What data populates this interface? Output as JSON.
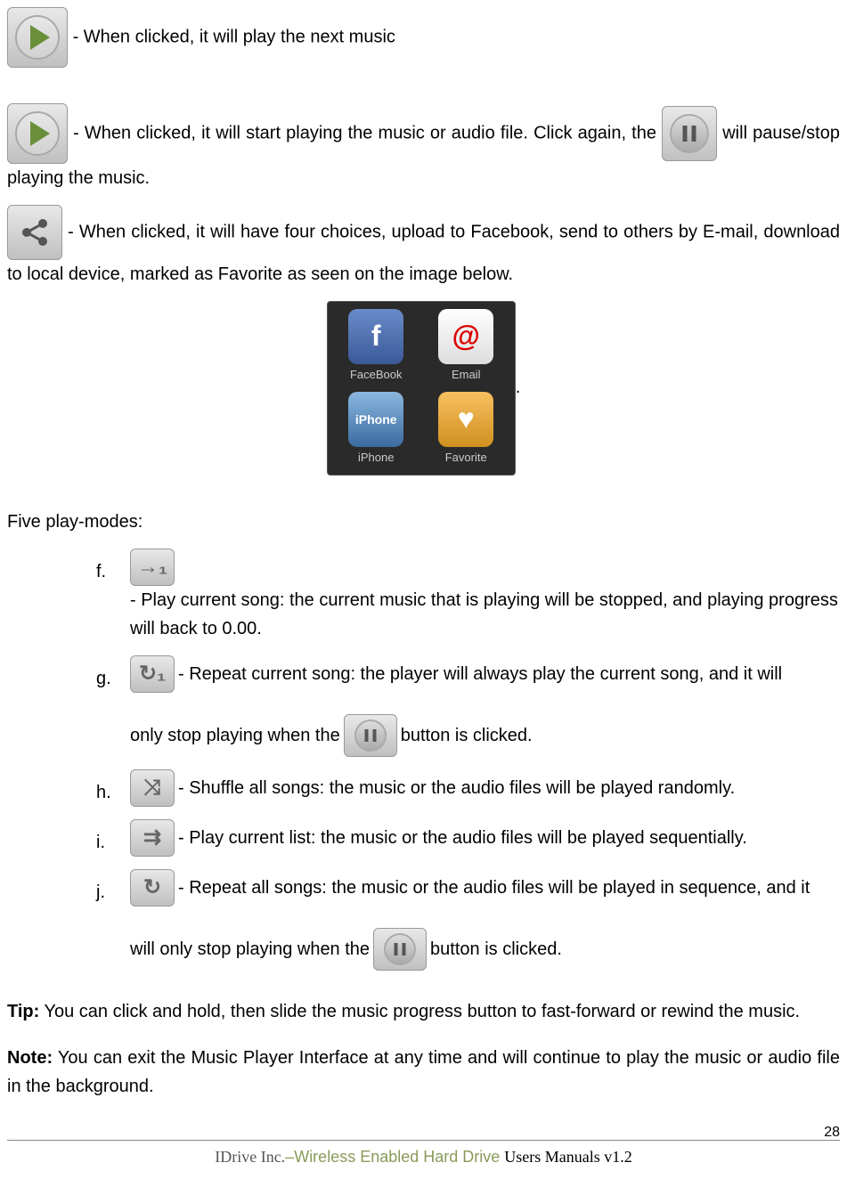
{
  "line_next_music": "- When clicked, it will play the next music",
  "line_play_a": "- When clicked, it will start playing the music or audio file.  Click again, the",
  "line_play_b": "will pause/stop playing the music.",
  "line_share_a": "- When clicked, it will have four choices, upload to Facebook, send to others by E-mail, download to local device, marked as Favorite as seen on the image below.",
  "share_labels": {
    "facebook": "FaceBook",
    "email": "Email",
    "iphone": "iPhone",
    "favorite": "Favorite"
  },
  "period": ".",
  "five_play_modes": "Five play-modes:",
  "modes": {
    "f": {
      "marker": "f.",
      "text": "- Play current song: the current music that is playing will be stopped, and playing progress will back to 0.00."
    },
    "g": {
      "marker": "g.",
      "text_a": "- Repeat current song: the player will always play the current song, and it will",
      "text_b": "only stop playing when the",
      "text_c": "button is clicked."
    },
    "h": {
      "marker": "h.",
      "text": "- Shuffle all songs: the music or the audio files will be played randomly."
    },
    "i": {
      "marker": "i.",
      "text": "- Play current list: the music or the audio files will be played sequentially."
    },
    "j": {
      "marker": "j.",
      "text_a": "- Repeat all songs: the music or the audio files will be played in sequence, and it",
      "text_b": "will only stop playing when the ",
      "text_c": "button is clicked."
    }
  },
  "tip_label": "Tip:",
  "tip_text": " You can click and hold, then slide the music progress button to fast-forward or rewind the music.",
  "note_label": "Note:",
  "note_text": " You can exit the Music Player Interface at any time and will continue to play the music or audio file in the background.",
  "footer_company": "IDrive Inc.",
  "footer_product": "–Wireless Enabled Hard Drive  ",
  "footer_manual": "Users Manuals v1.2",
  "page_number": "28"
}
